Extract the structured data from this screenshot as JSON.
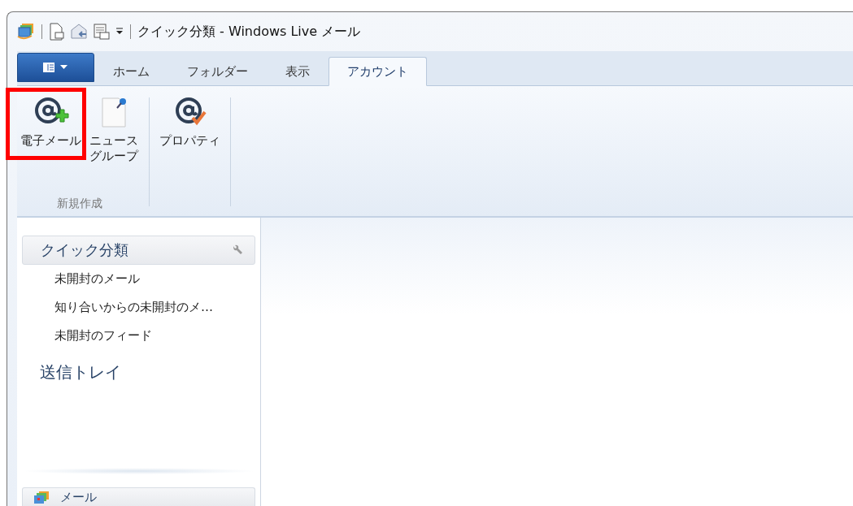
{
  "window": {
    "title": "クイック分類 - Windows Live メール"
  },
  "tabs": [
    {
      "label": "ホーム",
      "selected": false
    },
    {
      "label": "フォルダー",
      "selected": false
    },
    {
      "label": "表示",
      "selected": false
    },
    {
      "label": "アカウント",
      "selected": true
    }
  ],
  "ribbon": {
    "groups": [
      {
        "label": "新規作成",
        "buttons": [
          {
            "label": "電子メール",
            "kind": "email-add",
            "highlighted": true
          },
          {
            "label": "ニュースグループ",
            "kind": "newsgroup",
            "highlighted": false
          }
        ]
      },
      {
        "buttons": [
          {
            "label": "プロパティ",
            "kind": "properties",
            "highlighted": false
          }
        ]
      }
    ]
  },
  "sidebar": {
    "quick_views": {
      "title": "クイック分類",
      "items": [
        "未開封のメール",
        "知り合いからの未開封のメ…",
        "未開封のフィード"
      ]
    },
    "outbox": "送信トレイ",
    "bottom_section": "メール"
  }
}
